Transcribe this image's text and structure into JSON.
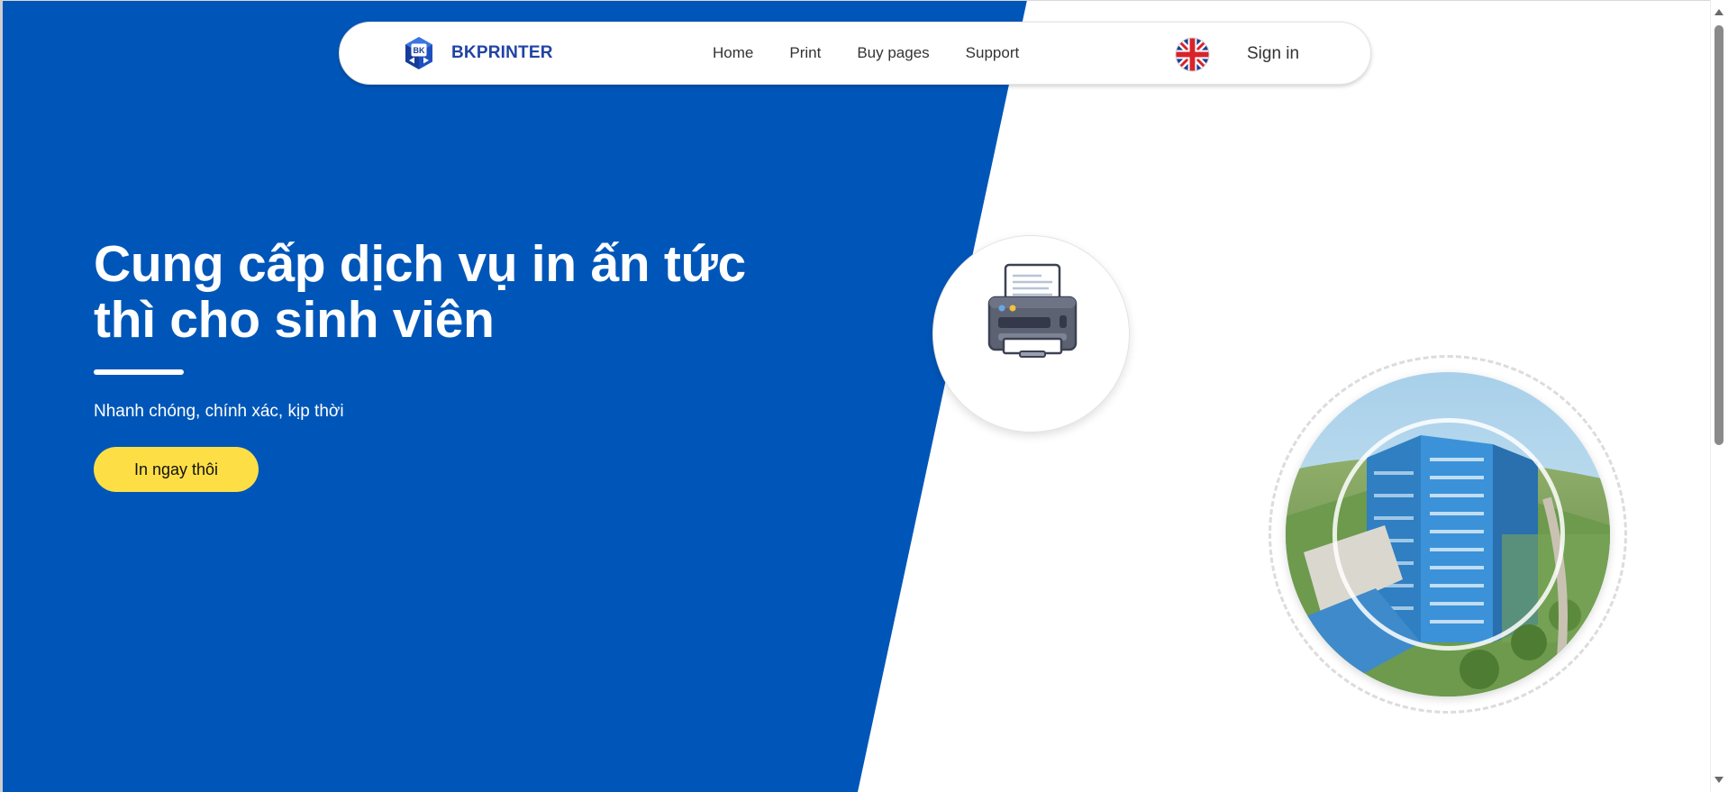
{
  "navbar": {
    "brand_name": "BKPRINTER",
    "logo_text": "BK",
    "links": [
      "Home",
      "Print",
      "Buy pages",
      "Support"
    ],
    "language_icon": "uk-flag-icon",
    "sign_in": "Sign in"
  },
  "hero": {
    "title": "Cung cấp dịch vụ in ấn tức thì cho sinh viên",
    "subtitle": "Nhanh chóng, chính xác, kịp thời",
    "cta_label": "In ngay thôi"
  },
  "images": {
    "printer_icon": "printer-icon",
    "campus_image": "campus-building-photo"
  },
  "colors": {
    "primary_blue": "#0056b8",
    "brand_text": "#2043a4",
    "cta_yellow": "#fddf45"
  },
  "scrollbar": {
    "position_fraction": 0.0
  }
}
